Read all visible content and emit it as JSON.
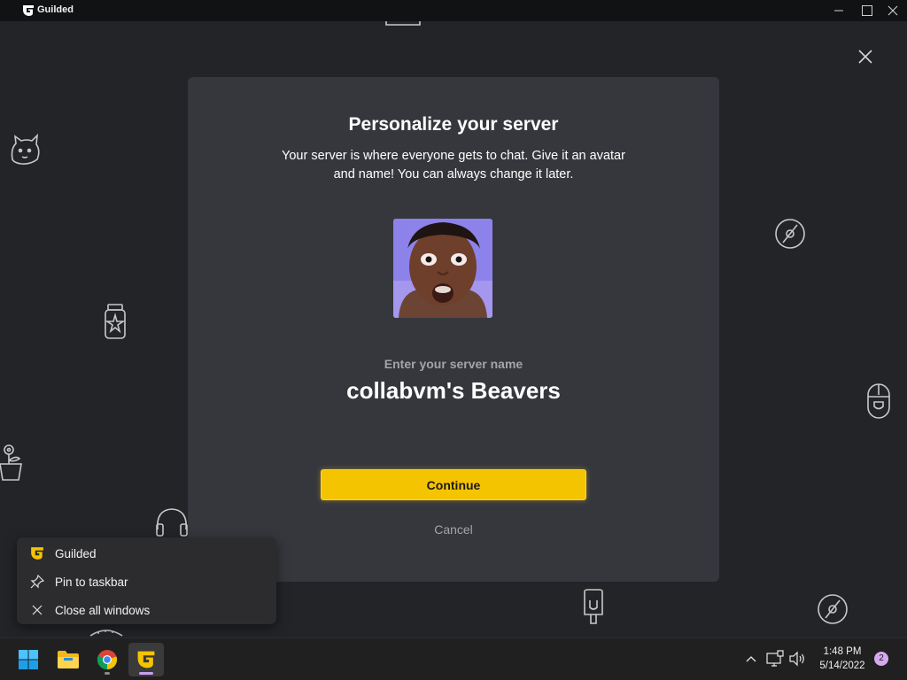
{
  "window": {
    "title": "Guilded",
    "logo_icon": "guilded-logo-icon",
    "controls": [
      "minimize-icon",
      "maximize-icon",
      "close-icon"
    ]
  },
  "colors": {
    "accent": "#f5c400",
    "modal_bg": "#36373d",
    "app_bg": "#232428",
    "taskbar_bg": "#202020"
  },
  "modal": {
    "title": "Personalize your server",
    "subtitle_line1": "Your server is where everyone gets to chat. Give it an avatar",
    "subtitle_line2": "and name! You can always change it later.",
    "avatar_alt": "server avatar photo",
    "name_label": "Enter your server name",
    "name_value": "collabvm's Beavers",
    "continue_label": "Continue",
    "cancel_label": "Cancel"
  },
  "jumplist": {
    "items": [
      {
        "label": "Guilded",
        "icon": "guilded-logo-icon"
      },
      {
        "label": "Pin to taskbar",
        "icon": "pin-icon"
      },
      {
        "label": "Close all windows",
        "icon": "close-icon"
      }
    ]
  },
  "taskbar": {
    "apps": [
      "windows-start-icon",
      "file-explorer-icon",
      "chrome-icon",
      "guilded-icon"
    ],
    "clock_time": "1:48 PM",
    "clock_date": "5/14/2022",
    "notification_count": "2"
  }
}
